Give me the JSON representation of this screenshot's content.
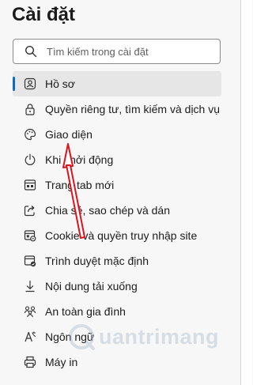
{
  "page": {
    "title": "Cài đặt"
  },
  "search": {
    "placeholder": "Tìm kiếm trong cài đặt",
    "value": ""
  },
  "menu": {
    "items": [
      {
        "label": "Hồ sơ",
        "icon": "profile-icon",
        "active": true
      },
      {
        "label": "Quyền riêng tư, tìm kiếm và dịch vụ",
        "icon": "lock-icon"
      },
      {
        "label": "Giao diện",
        "icon": "palette-icon"
      },
      {
        "label": "Khi khởi động",
        "icon": "power-icon"
      },
      {
        "label": "Trang tab mới",
        "icon": "new-tab-icon"
      },
      {
        "label": "Chia sẻ, sao chép và dán",
        "icon": "share-icon"
      },
      {
        "label": "Cookie và quyền truy nhập site",
        "icon": "site-permissions-icon"
      },
      {
        "label": "Trình duyệt mặc định",
        "icon": "default-browser-icon"
      },
      {
        "label": "Nội dung tải xuống",
        "icon": "download-icon"
      },
      {
        "label": "An toàn gia đình",
        "icon": "family-icon"
      },
      {
        "label": "Ngôn ngữ",
        "icon": "language-icon"
      },
      {
        "label": "Máy in",
        "icon": "printer-icon"
      }
    ]
  },
  "watermark": {
    "text": "uantrimang"
  },
  "colors": {
    "accent": "#0f6cbd",
    "arrow": "#e0121b"
  }
}
